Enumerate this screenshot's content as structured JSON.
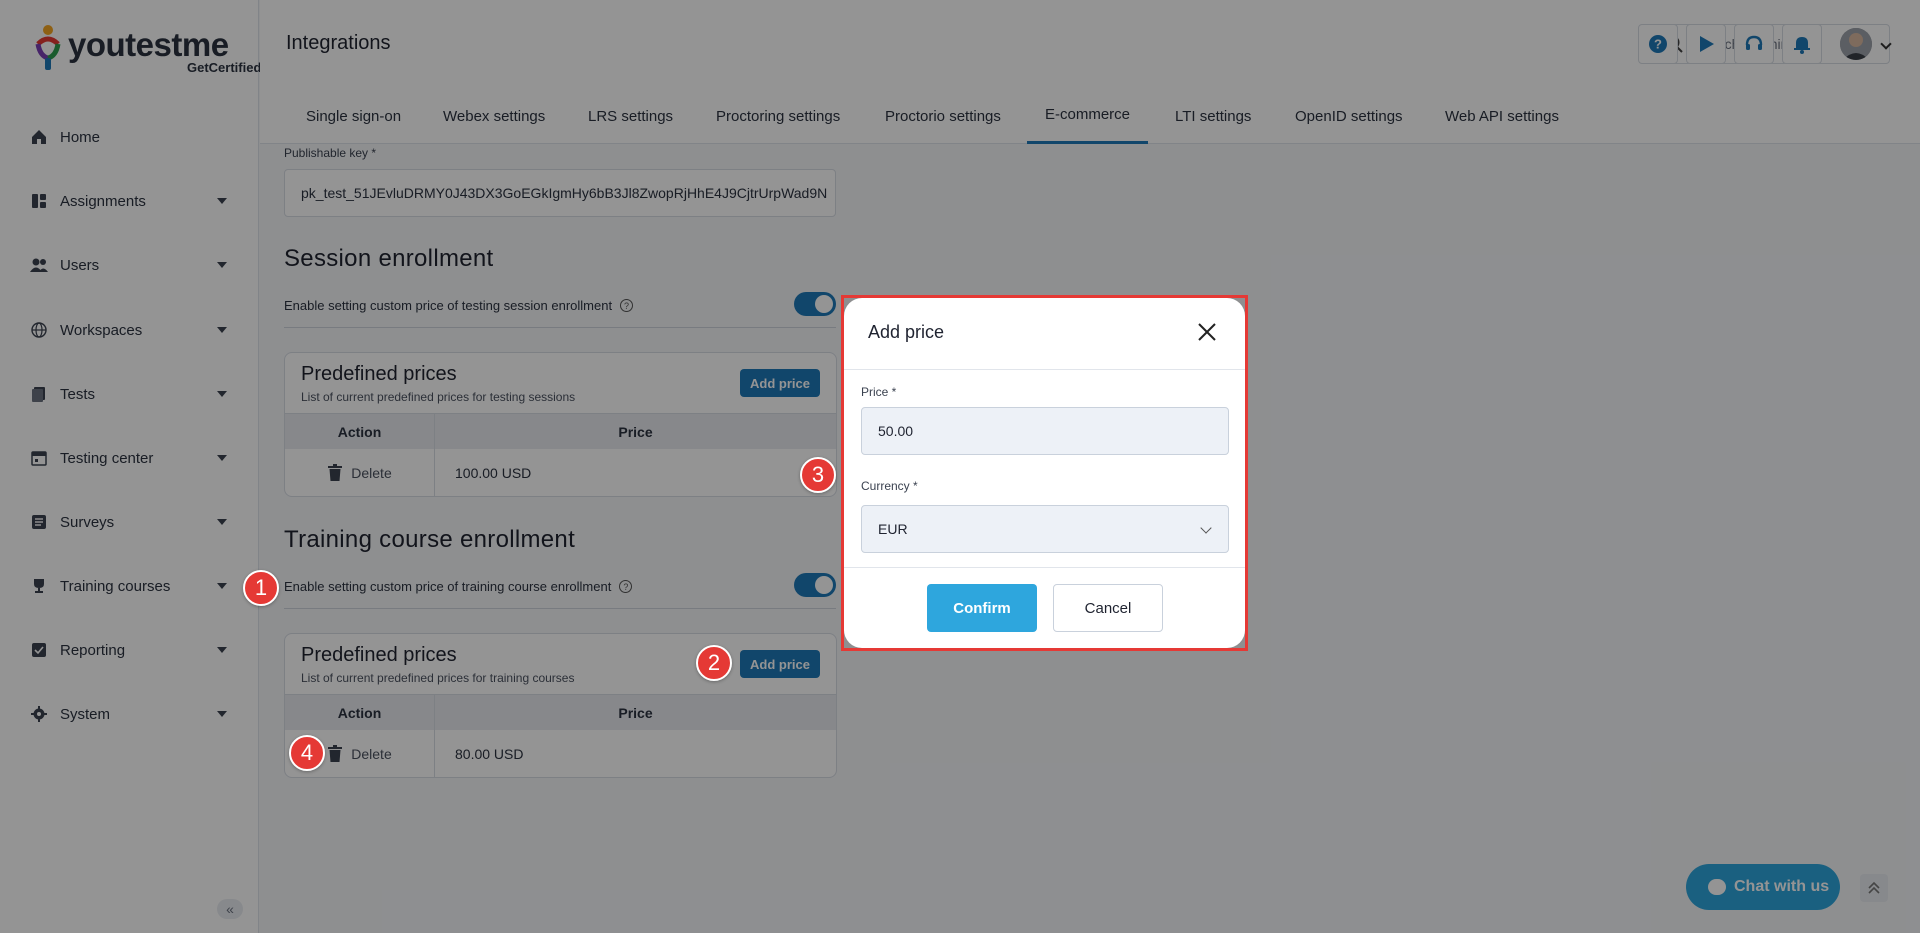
{
  "app": {
    "brand": "youtestme",
    "brand_sub": "GetCertified"
  },
  "sidebar": {
    "items": [
      {
        "label": "Home",
        "icon": "home-icon",
        "has_caret": false
      },
      {
        "label": "Assignments",
        "icon": "assignments-icon",
        "has_caret": true
      },
      {
        "label": "Users",
        "icon": "users-icon",
        "has_caret": true
      },
      {
        "label": "Workspaces",
        "icon": "globe-icon",
        "has_caret": true
      },
      {
        "label": "Tests",
        "icon": "tests-icon",
        "has_caret": true
      },
      {
        "label": "Testing center",
        "icon": "calendar-icon",
        "has_caret": true
      },
      {
        "label": "Surveys",
        "icon": "survey-icon",
        "has_caret": true
      },
      {
        "label": "Training courses",
        "icon": "trophy-icon",
        "has_caret": true
      },
      {
        "label": "Reporting",
        "icon": "reporting-icon",
        "has_caret": true
      },
      {
        "label": "System",
        "icon": "gear-icon",
        "has_caret": true
      }
    ],
    "collapse_glyph": "«"
  },
  "header": {
    "title": "Integrations",
    "search_placeholder": "Search anything"
  },
  "tabs": [
    {
      "label": "Single sign-on",
      "active": false
    },
    {
      "label": "Webex settings",
      "active": false
    },
    {
      "label": "LRS settings",
      "active": false
    },
    {
      "label": "Proctoring settings",
      "active": false
    },
    {
      "label": "Proctorio settings",
      "active": false
    },
    {
      "label": "E-commerce",
      "active": true
    },
    {
      "label": "LTI settings",
      "active": false
    },
    {
      "label": "OpenID settings",
      "active": false
    },
    {
      "label": "Web API settings",
      "active": false
    }
  ],
  "content": {
    "publishable_key_label": "Publishable key *",
    "publishable_key_value": "pk_test_51JEvluDRMY0J43DX3GoEGkIgmHy6bB3Jl8ZwopRjHhE4J9CjtrUrpWad9N",
    "session": {
      "title": "Session enrollment",
      "toggle_label": "Enable setting custom price of testing session enrollment",
      "toggle_on": true,
      "card_title": "Predefined prices",
      "card_subtitle": "List of current predefined prices for testing sessions",
      "add_label": "Add price",
      "col_action": "Action",
      "col_price": "Price",
      "rows": [
        {
          "action": "Delete",
          "price": "100.00 USD"
        }
      ]
    },
    "training": {
      "title": "Training course enrollment",
      "toggle_label": "Enable setting custom price of training course enrollment",
      "toggle_on": true,
      "card_title": "Predefined prices",
      "card_subtitle": "List of current predefined prices for training courses",
      "add_label": "Add price",
      "col_action": "Action",
      "col_price": "Price",
      "rows": [
        {
          "action": "Delete",
          "price": "80.00 USD"
        }
      ]
    }
  },
  "modal": {
    "title": "Add price",
    "price_label": "Price *",
    "price_value": "50.00",
    "currency_label": "Currency *",
    "currency_value": "EUR",
    "confirm_label": "Confirm",
    "cancel_label": "Cancel"
  },
  "badges": [
    "1",
    "2",
    "3",
    "4"
  ],
  "chat": {
    "label": "Chat with us"
  },
  "colors": {
    "accent": "#1e79b8",
    "confirm": "#2ea6dd",
    "badge": "#e53935",
    "highlight_frame": "#e53935"
  }
}
